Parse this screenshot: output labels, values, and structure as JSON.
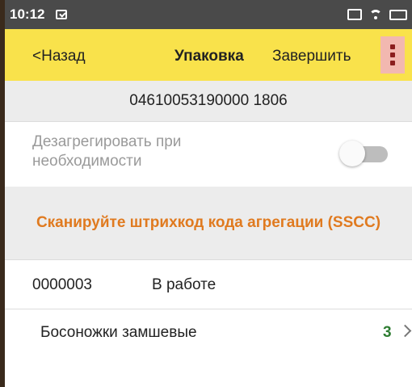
{
  "status_bar": {
    "time": "10:12"
  },
  "toolbar": {
    "back_label": "<Назад",
    "title": "Упаковка",
    "finish_label": "Завершить",
    "accent_color": "#f9e24b"
  },
  "barcode": "04610053190000 1806",
  "toggle": {
    "label": "Дезагрегировать при необходимости",
    "checked": false
  },
  "scan_prompt": "Сканируйте штрихкод кода агрегации (SSCC)",
  "document": {
    "number": "0000003",
    "status": "В работе"
  },
  "items": [
    {
      "name": "Босоножки замшевые",
      "quantity": "3"
    }
  ],
  "icons": [
    "notification-icon",
    "cast-icon",
    "wifi-icon",
    "battery-icon",
    "more-vert-icon",
    "chevron-right-icon"
  ]
}
